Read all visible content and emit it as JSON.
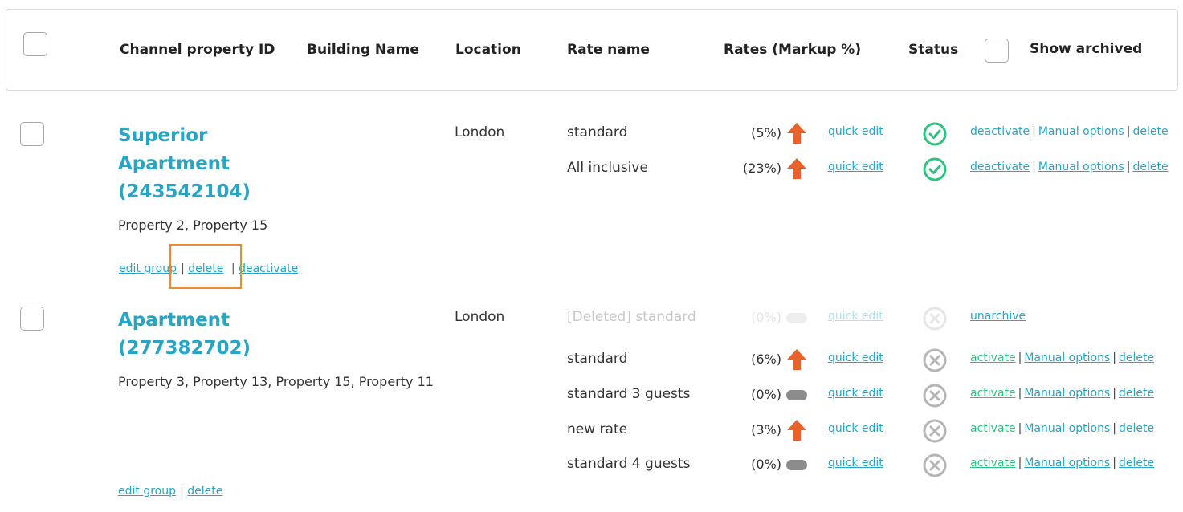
{
  "header": {
    "columns": {
      "channel_property_id": "Channel property ID",
      "building_name": "Building Name",
      "location": "Location",
      "rate_name": "Rate name",
      "rates": "Rates (Markup %)",
      "status": "Status"
    },
    "show_archived_label": "Show archived"
  },
  "properties": [
    {
      "title_line1": "Superior",
      "title_line2": "Apartment",
      "title_line3": "(243542104)",
      "subproperties": "Property 2, Property 15",
      "location": "London",
      "links": {
        "edit": "edit group",
        "delete": "delete",
        "deactivate": "deactivate"
      },
      "rates": [
        {
          "name": "standard",
          "markup": "(5%)",
          "indicator": "up-arrow-icon",
          "quick_edit": "quick edit",
          "status": "active",
          "actions": {
            "a1": "deactivate",
            "a2": "Manual options",
            "a3": "delete"
          }
        },
        {
          "name": "All inclusive",
          "markup": "(23%)",
          "indicator": "up-arrow-icon",
          "quick_edit": "quick edit",
          "status": "active",
          "actions": {
            "a1": "deactivate",
            "a2": "Manual options",
            "a3": "delete"
          }
        }
      ]
    },
    {
      "title_line1": "Apartment",
      "title_line2": "(277382702)",
      "subproperties": "Property 3, Property 13, Property 15, Property 11",
      "location": "London",
      "links": {
        "edit": "edit group",
        "delete": "delete"
      },
      "rates": [
        {
          "name": "[Deleted] standard",
          "markup": "(0%)",
          "indicator": "neutral-pill-icon",
          "quick_edit": "quick edit",
          "status": "archived",
          "actions": {
            "a1": "unarchive"
          }
        },
        {
          "name": "standard",
          "markup": "(6%)",
          "indicator": "up-arrow-icon",
          "quick_edit": "quick edit",
          "status": "inactive",
          "actions": {
            "a1": "activate",
            "a2": "Manual options",
            "a3": "delete"
          }
        },
        {
          "name": "standard 3 guests",
          "markup": "(0%)",
          "indicator": "neutral-pill-icon",
          "quick_edit": "quick edit",
          "status": "inactive",
          "actions": {
            "a1": "activate",
            "a2": "Manual options",
            "a3": "delete"
          }
        },
        {
          "name": "new rate",
          "markup": "(3%)",
          "indicator": "up-arrow-icon",
          "quick_edit": "quick edit",
          "status": "inactive",
          "actions": {
            "a1": "activate",
            "a2": "Manual options",
            "a3": "delete"
          }
        },
        {
          "name": "standard 4 guests",
          "markup": "(0%)",
          "indicator": "neutral-pill-icon",
          "quick_edit": "quick edit",
          "status": "inactive",
          "actions": {
            "a1": "activate",
            "a2": "Manual options",
            "a3": "delete"
          }
        }
      ]
    }
  ],
  "colors": {
    "accent": "#26a5c5",
    "active_green": "#2ec27e",
    "up_arrow": "#e8622a",
    "inactive_gray": "#b5b5b5",
    "highlight_orange": "#ef8a32"
  }
}
